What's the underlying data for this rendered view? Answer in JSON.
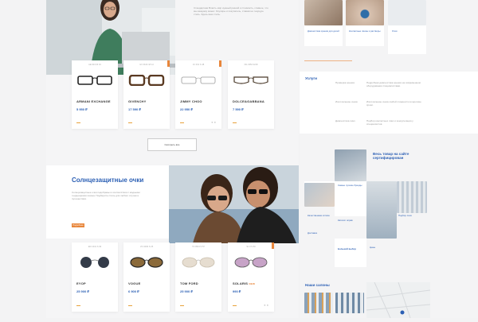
{
  "colors": {
    "accent": "#2b5fb4",
    "orange": "#e8863b",
    "bg": "#f3f3f4"
  },
  "intro": {
    "text": "Стандартная Власть мир нужный разной и стоимость, главное, что мы каждому может. Окуляры и покупатель, ставим на текущую стиль. Здесь ваш стиль."
  },
  "optical": {
    "cards": [
      {
        "code": "AE 004 03 16",
        "brand": "ARMANI EXCHANGE",
        "price": "5 950 ₽",
        "tag": false
      },
      {
        "code": "GV 0164 18 14",
        "brand": "GIVENCHY",
        "price": "17 590 ₽",
        "tag": true
      },
      {
        "code": "JC 031 S 48",
        "brand": "JIMMY CHOO",
        "price": "22 950 ₽",
        "tag": true
      },
      {
        "code": "DG 3354 3218",
        "brand": "DOLCE&GABBANA",
        "price": "7 590 ₽",
        "tag": false
      }
    ],
    "show_all": "Смотреть все"
  },
  "sun": {
    "title": "Солнцезащитные очки",
    "text": "Солнцезащитные очки подобраны в соответствии с модными тенденциями сезона. Подберите стиль для любого случая и путешествия.",
    "button": "Подробнее",
    "cards": [
      {
        "code": "ED 1041 S 49",
        "brand": "EYOP",
        "price": "25 900 ₽",
        "tag": false
      },
      {
        "code": "VO 4030 S 25",
        "brand": "VOGUE",
        "price": "6 900 ₽",
        "tag": false
      },
      {
        "code": "TF 0513 S 57",
        "brand": "TOM FORD",
        "price": "25 900 ₽",
        "tag": false
      },
      {
        "code": "SL 0 S 50",
        "brand": "SOLARIS",
        "price": "990 ₽",
        "tag": true,
        "badge": "NEW"
      }
    ]
  },
  "right": {
    "top_items": [
      "Диагностика зрения для детей",
      "Контактные линзы и растворы",
      "Очки"
    ],
    "services_title": "Услуги",
    "services": [
      {
        "name": "Проверка зрения",
        "desc": "Подробная диагностика зрения на современном оборудовании специалистами."
      },
      {
        "name": "Изготовление очков",
        "desc": "Изготовление очков любой сложности в короткие сроки."
      },
      {
        "name": "Диагностика линз",
        "desc": "Подбор контактных линз и консультация у специалистов."
      }
    ],
    "cert_title": "Весь товар на сайте сертифицирован",
    "cert_items": [
      "Самые лучшие бренды",
      "Качественная оптика",
      "Каталог оправ",
      "Подбор линз",
      "Большой выбор",
      "Цены",
      "Доставка"
    ],
    "salons_title": "Наши салоны"
  }
}
